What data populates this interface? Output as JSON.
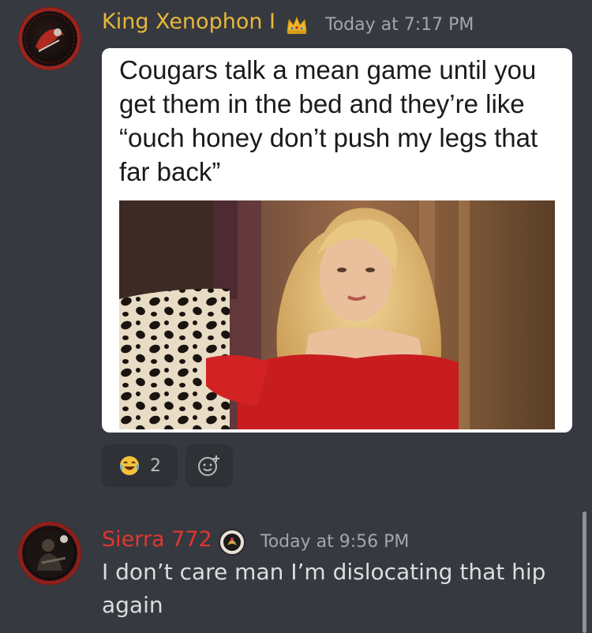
{
  "messages": [
    {
      "username": "King Xenophon I",
      "username_color": "#e8b83a",
      "badge_icon": "crown-icon",
      "timestamp": "Today at 7:17 PM",
      "meme": {
        "caption": "Cougars talk a mean game until you get them in the bed and they’re like “ouch honey don’t push my legs that far back”"
      },
      "reactions": [
        {
          "emoji_icon": "joy-emoji-icon",
          "count": "2"
        }
      ],
      "add_reaction_icon": "add-reaction-icon"
    },
    {
      "username": "Sierra 772",
      "username_color": "#e1372f",
      "badge_icon": "emblem-badge-icon",
      "timestamp": "Today at 9:56 PM",
      "text": "I don’t care man I’m dislocating that hip again"
    }
  ],
  "colors": {
    "background": "#36393f",
    "timestamp": "#a3a6aa",
    "message_text": "#dcddde"
  }
}
